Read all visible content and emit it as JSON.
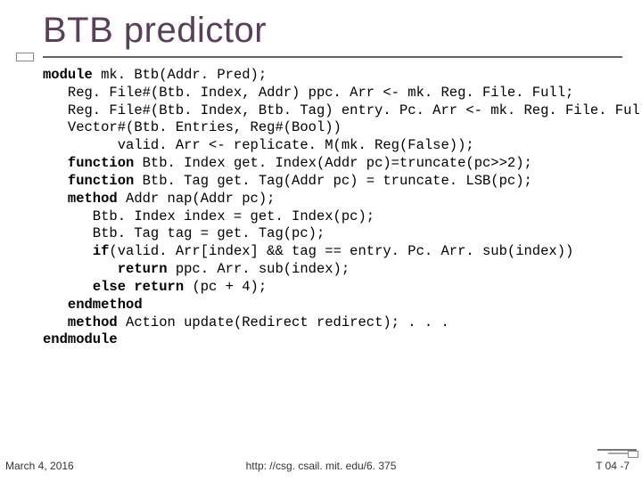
{
  "title": "BTB predictor",
  "code": {
    "l1a": "module",
    "l1b": " mk. Btb(Addr. Pred);",
    "l2": "   Reg. File#(Btb. Index, Addr) ppc. Arr <- mk. Reg. File. Full;",
    "l3": "   Reg. File#(Btb. Index, Btb. Tag) entry. Pc. Arr <- mk. Reg. File. Full;",
    "l4": "   Vector#(Btb. Entries, Reg#(Bool))",
    "l5": "         valid. Arr <- replicate. M(mk. Reg(False));",
    "l6a": "   ",
    "l6b": "function",
    "l6c": " Btb. Index get. Index(Addr pc)=truncate(pc>>2);",
    "l7a": "   ",
    "l7b": "function",
    "l7c": " Btb. Tag get. Tag(Addr pc) = truncate. LSB(pc);",
    "l8a": "   ",
    "l8b": "method",
    "l8c": " Addr nap(Addr pc);",
    "l9": "      Btb. Index index = get. Index(pc);",
    "l10": "      Btb. Tag tag = get. Tag(pc);",
    "l11a": "      ",
    "l11b": "if",
    "l11c": "(valid. Arr[index] && tag == entry. Pc. Arr. sub(index))",
    "l12a": "         ",
    "l12b": "return",
    "l12c": " ppc. Arr. sub(index);",
    "l13a": "      ",
    "l13b": "else return",
    "l13c": " (pc + 4);",
    "l14a": "   ",
    "l14b": "endmethod",
    "l15a": "   ",
    "l15b": "method",
    "l15c": " Action update(Redirect redirect); . . .",
    "l16": "endmodule"
  },
  "footer": {
    "left": "March 4, 2016",
    "center": "http: //csg. csail. mit. edu/6. 375",
    "right": "T 04 -7"
  }
}
